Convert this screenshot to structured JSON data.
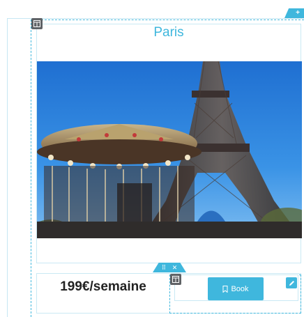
{
  "card": {
    "title": "Paris",
    "image_alt": "Eiffel Tower and carousel"
  },
  "offer": {
    "price": "199€/semaine",
    "book_label": "Book"
  },
  "editor": {
    "add_glyph": "+",
    "move_glyph": "⠿",
    "close_glyph": "✕",
    "accent_color": "#3fb7dd",
    "handle_color": "#5f6266"
  },
  "icons": [
    "plus-icon",
    "column-handle-icon",
    "drag-handle-icon",
    "close-icon",
    "bookmark-icon",
    "pencil-icon"
  ]
}
